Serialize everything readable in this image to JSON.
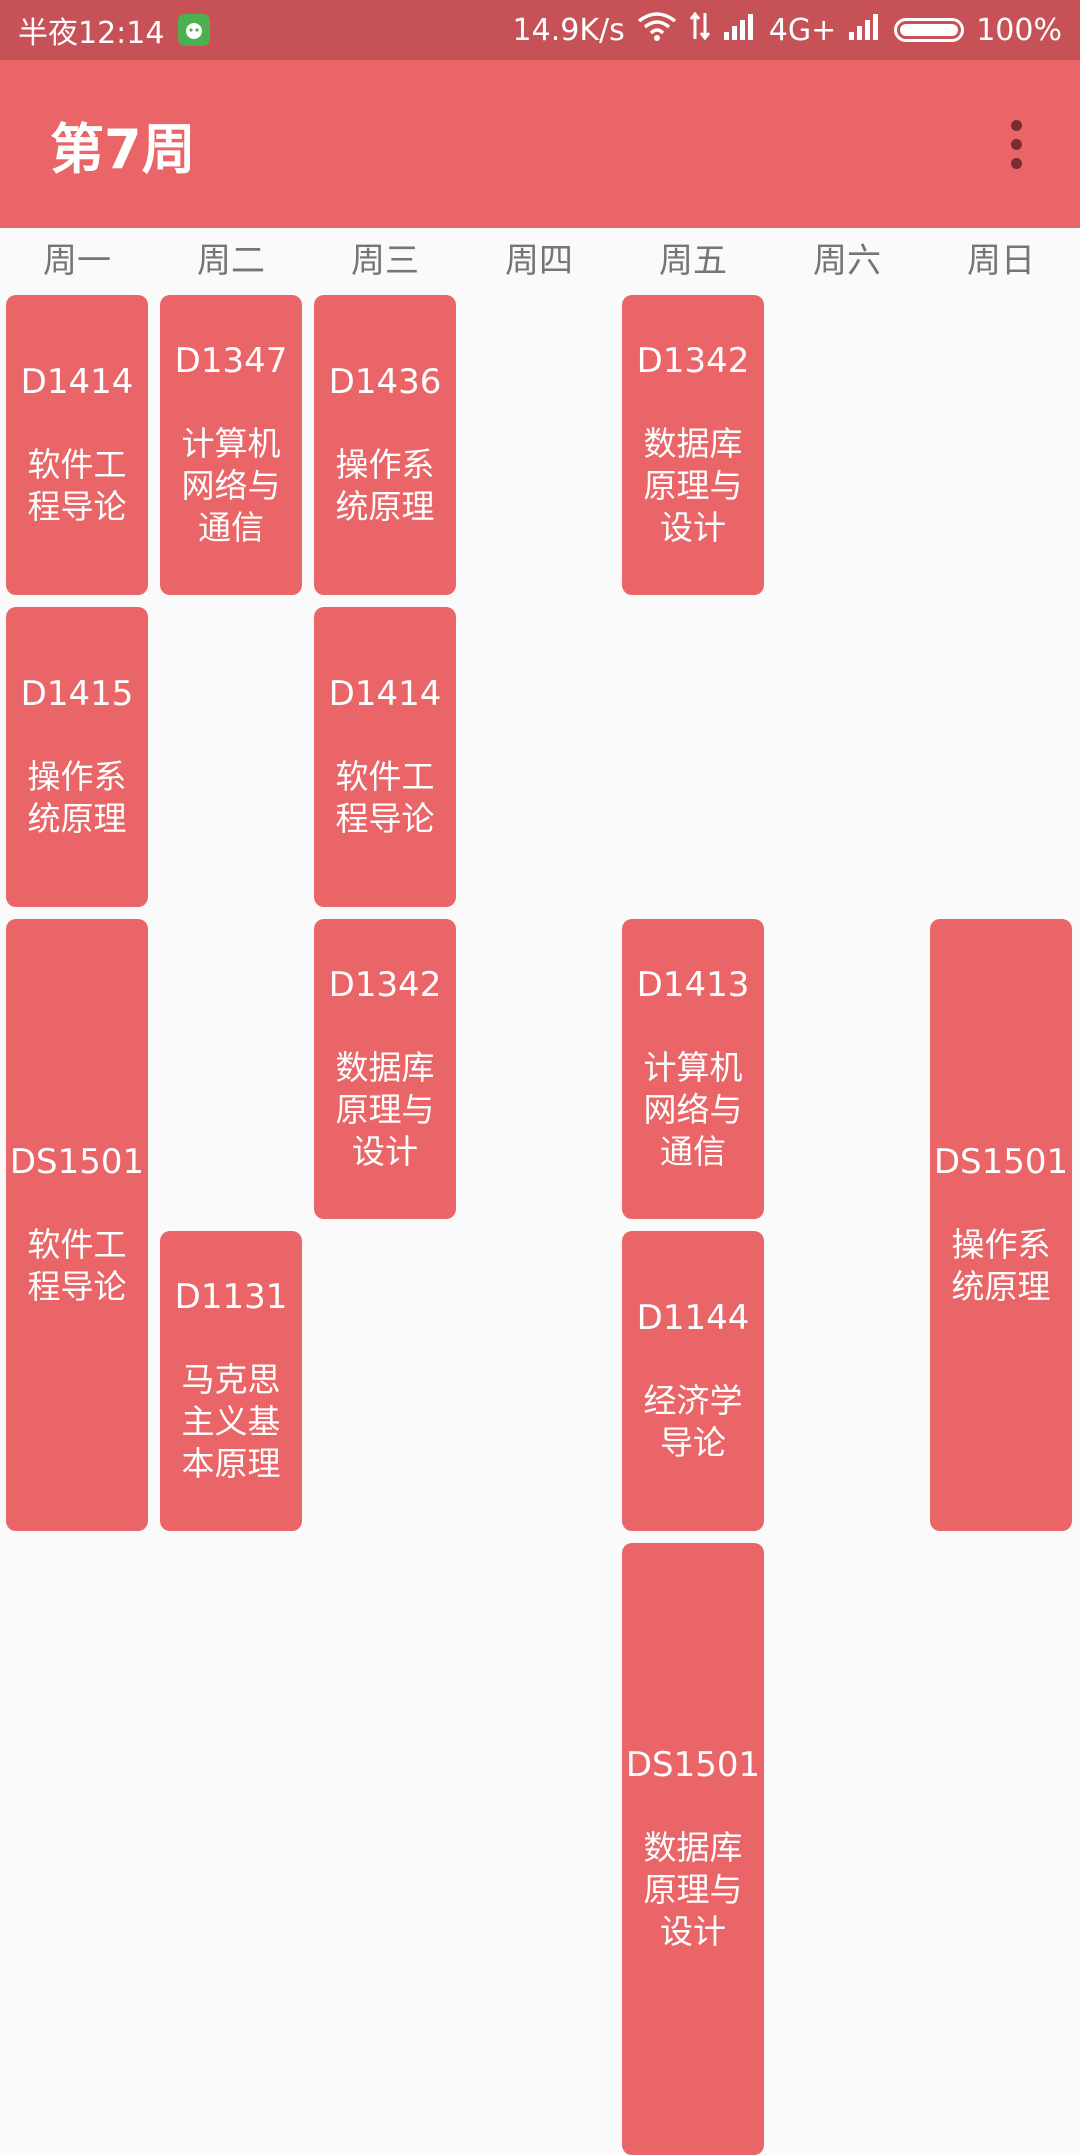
{
  "status_bar": {
    "time": "半夜12:14",
    "net_speed": "14.9K/s",
    "network": "4G+",
    "battery": "100%",
    "battery_level": 100
  },
  "toolbar": {
    "title": "第7周",
    "menu_icon": "more-vert-icon"
  },
  "days": [
    "周一",
    "周二",
    "周三",
    "周四",
    "周五",
    "周六",
    "周日"
  ],
  "courses": [
    {
      "day": 0,
      "start": 1,
      "len": 2,
      "room": "D1414",
      "name": "软件工程导论"
    },
    {
      "day": 1,
      "start": 1,
      "len": 2,
      "room": "D1347",
      "name": "计算机网络与通信"
    },
    {
      "day": 2,
      "start": 1,
      "len": 2,
      "room": "D1436",
      "name": "操作系统原理"
    },
    {
      "day": 4,
      "start": 1,
      "len": 2,
      "room": "D1342",
      "name": "数据库原理与设计"
    },
    {
      "day": 0,
      "start": 3,
      "len": 2,
      "room": "D1415",
      "name": "操作系统原理"
    },
    {
      "day": 2,
      "start": 3,
      "len": 2,
      "room": "D1414",
      "name": "软件工程导论"
    },
    {
      "day": 0,
      "start": 5,
      "len": 4,
      "room": "DS1501",
      "name": "软件工程导论"
    },
    {
      "day": 2,
      "start": 5,
      "len": 2,
      "room": "D1342",
      "name": "数据库原理与设计"
    },
    {
      "day": 4,
      "start": 5,
      "len": 2,
      "room": "D1413",
      "name": "计算机网络与通信"
    },
    {
      "day": 6,
      "start": 5,
      "len": 4,
      "room": "DS1501",
      "name": "操作系统原理"
    },
    {
      "day": 1,
      "start": 7,
      "len": 2,
      "room": "D1131",
      "name": "马克思主义基本原理"
    },
    {
      "day": 4,
      "start": 7,
      "len": 2,
      "room": "D1144",
      "name": "经济学导论"
    },
    {
      "day": 4,
      "start": 9,
      "len": 4,
      "room": "DS1501",
      "name": "数据库原理与设计"
    }
  ]
}
